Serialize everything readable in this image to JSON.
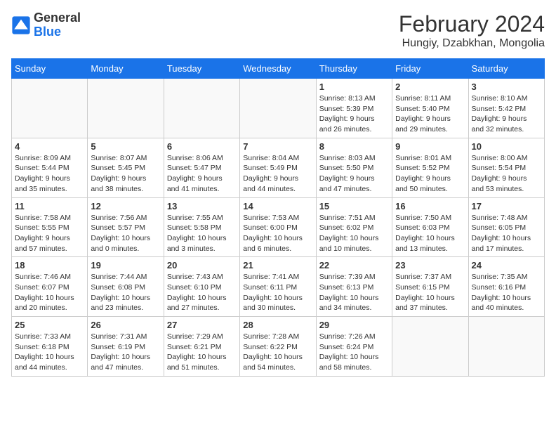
{
  "header": {
    "logo_general": "General",
    "logo_blue": "Blue",
    "month_title": "February 2024",
    "location": "Hungiy, Dzabkhan, Mongolia"
  },
  "weekdays": [
    "Sunday",
    "Monday",
    "Tuesday",
    "Wednesday",
    "Thursday",
    "Friday",
    "Saturday"
  ],
  "weeks": [
    [
      {
        "day": "",
        "info": ""
      },
      {
        "day": "",
        "info": ""
      },
      {
        "day": "",
        "info": ""
      },
      {
        "day": "",
        "info": ""
      },
      {
        "day": "1",
        "info": "Sunrise: 8:13 AM\nSunset: 5:39 PM\nDaylight: 9 hours\nand 26 minutes."
      },
      {
        "day": "2",
        "info": "Sunrise: 8:11 AM\nSunset: 5:40 PM\nDaylight: 9 hours\nand 29 minutes."
      },
      {
        "day": "3",
        "info": "Sunrise: 8:10 AM\nSunset: 5:42 PM\nDaylight: 9 hours\nand 32 minutes."
      }
    ],
    [
      {
        "day": "4",
        "info": "Sunrise: 8:09 AM\nSunset: 5:44 PM\nDaylight: 9 hours\nand 35 minutes."
      },
      {
        "day": "5",
        "info": "Sunrise: 8:07 AM\nSunset: 5:45 PM\nDaylight: 9 hours\nand 38 minutes."
      },
      {
        "day": "6",
        "info": "Sunrise: 8:06 AM\nSunset: 5:47 PM\nDaylight: 9 hours\nand 41 minutes."
      },
      {
        "day": "7",
        "info": "Sunrise: 8:04 AM\nSunset: 5:49 PM\nDaylight: 9 hours\nand 44 minutes."
      },
      {
        "day": "8",
        "info": "Sunrise: 8:03 AM\nSunset: 5:50 PM\nDaylight: 9 hours\nand 47 minutes."
      },
      {
        "day": "9",
        "info": "Sunrise: 8:01 AM\nSunset: 5:52 PM\nDaylight: 9 hours\nand 50 minutes."
      },
      {
        "day": "10",
        "info": "Sunrise: 8:00 AM\nSunset: 5:54 PM\nDaylight: 9 hours\nand 53 minutes."
      }
    ],
    [
      {
        "day": "11",
        "info": "Sunrise: 7:58 AM\nSunset: 5:55 PM\nDaylight: 9 hours\nand 57 minutes."
      },
      {
        "day": "12",
        "info": "Sunrise: 7:56 AM\nSunset: 5:57 PM\nDaylight: 10 hours\nand 0 minutes."
      },
      {
        "day": "13",
        "info": "Sunrise: 7:55 AM\nSunset: 5:58 PM\nDaylight: 10 hours\nand 3 minutes."
      },
      {
        "day": "14",
        "info": "Sunrise: 7:53 AM\nSunset: 6:00 PM\nDaylight: 10 hours\nand 6 minutes."
      },
      {
        "day": "15",
        "info": "Sunrise: 7:51 AM\nSunset: 6:02 PM\nDaylight: 10 hours\nand 10 minutes."
      },
      {
        "day": "16",
        "info": "Sunrise: 7:50 AM\nSunset: 6:03 PM\nDaylight: 10 hours\nand 13 minutes."
      },
      {
        "day": "17",
        "info": "Sunrise: 7:48 AM\nSunset: 6:05 PM\nDaylight: 10 hours\nand 17 minutes."
      }
    ],
    [
      {
        "day": "18",
        "info": "Sunrise: 7:46 AM\nSunset: 6:07 PM\nDaylight: 10 hours\nand 20 minutes."
      },
      {
        "day": "19",
        "info": "Sunrise: 7:44 AM\nSunset: 6:08 PM\nDaylight: 10 hours\nand 23 minutes."
      },
      {
        "day": "20",
        "info": "Sunrise: 7:43 AM\nSunset: 6:10 PM\nDaylight: 10 hours\nand 27 minutes."
      },
      {
        "day": "21",
        "info": "Sunrise: 7:41 AM\nSunset: 6:11 PM\nDaylight: 10 hours\nand 30 minutes."
      },
      {
        "day": "22",
        "info": "Sunrise: 7:39 AM\nSunset: 6:13 PM\nDaylight: 10 hours\nand 34 minutes."
      },
      {
        "day": "23",
        "info": "Sunrise: 7:37 AM\nSunset: 6:15 PM\nDaylight: 10 hours\nand 37 minutes."
      },
      {
        "day": "24",
        "info": "Sunrise: 7:35 AM\nSunset: 6:16 PM\nDaylight: 10 hours\nand 40 minutes."
      }
    ],
    [
      {
        "day": "25",
        "info": "Sunrise: 7:33 AM\nSunset: 6:18 PM\nDaylight: 10 hours\nand 44 minutes."
      },
      {
        "day": "26",
        "info": "Sunrise: 7:31 AM\nSunset: 6:19 PM\nDaylight: 10 hours\nand 47 minutes."
      },
      {
        "day": "27",
        "info": "Sunrise: 7:29 AM\nSunset: 6:21 PM\nDaylight: 10 hours\nand 51 minutes."
      },
      {
        "day": "28",
        "info": "Sunrise: 7:28 AM\nSunset: 6:22 PM\nDaylight: 10 hours\nand 54 minutes."
      },
      {
        "day": "29",
        "info": "Sunrise: 7:26 AM\nSunset: 6:24 PM\nDaylight: 10 hours\nand 58 minutes."
      },
      {
        "day": "",
        "info": ""
      },
      {
        "day": "",
        "info": ""
      }
    ]
  ]
}
